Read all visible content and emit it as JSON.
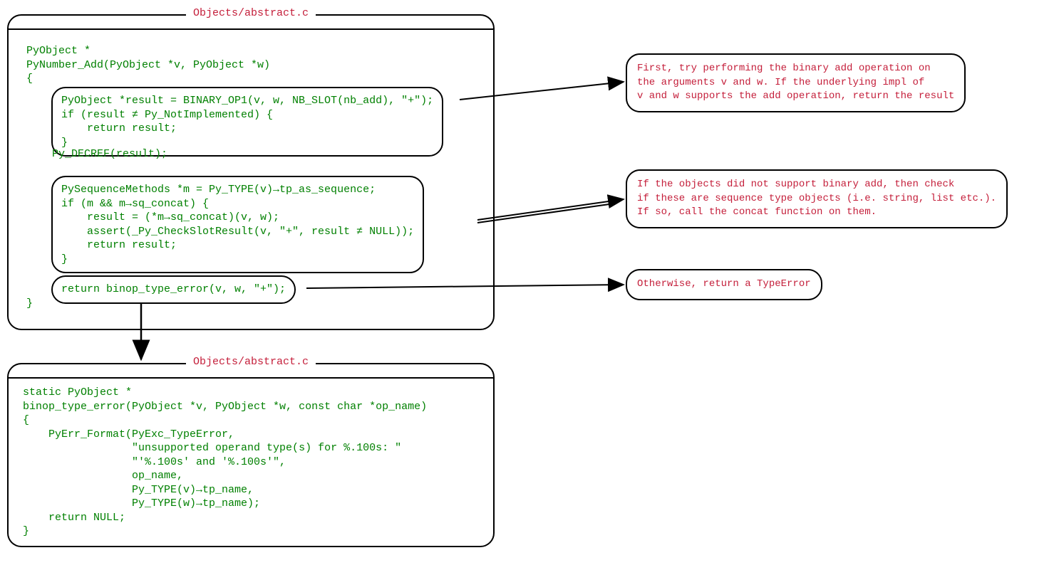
{
  "box1": {
    "title": "Objects/abstract.c",
    "header_lines": "PyObject *\nPyNumber_Add(PyObject *v, PyObject *w)\n{",
    "inner1": "PyObject *result = BINARY_OP1(v, w, NB_SLOT(nb_add), \"+\");\nif (result ≠ Py_NotImplemented) {\n    return result;\n}",
    "decref_line": "    Py_DECREF(result);",
    "inner2": "PySequenceMethods *m = Py_TYPE(v)→tp_as_sequence;\nif (m && m→sq_concat) {\n    result = (*m→sq_concat)(v, w);\n    assert(_Py_CheckSlotResult(v, \"+\", result ≠ NULL));\n    return result;\n}",
    "inner3": "return binop_type_error(v, w, \"+\");",
    "close_brace": "}"
  },
  "box2": {
    "title": "Objects/abstract.c",
    "code": "static PyObject *\nbinop_type_error(PyObject *v, PyObject *w, const char *op_name)\n{\n    PyErr_Format(PyExc_TypeError,\n                 \"unsupported operand type(s) for %.100s: \"\n                 \"'%.100s' and '%.100s'\",\n                 op_name,\n                 Py_TYPE(v)→tp_name,\n                 Py_TYPE(w)→tp_name);\n    return NULL;\n}"
  },
  "note1": "First, try performing the binary add operation on\nthe arguments v and w. If the underlying impl of\nv and w supports the add operation, return the result",
  "note2": "If the objects did not support binary add, then check\nif these are sequence type objects (i.e. string, list etc.).\nIf so, call the concat function on them.",
  "note3": "Otherwise, return a TypeError"
}
